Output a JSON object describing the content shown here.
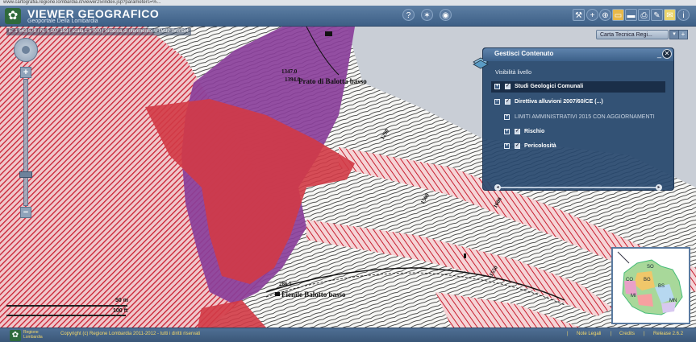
{
  "browser": {
    "url": "www.cartografia.regione.lombardia.it/viewer25/index.jsp?parameters=%..."
  },
  "header": {
    "title": "VIEWER GEOGRAFICO",
    "subtitle": "Geoportale Della Lombardia",
    "tool_icons": [
      "help-icon",
      "identify-icon",
      "globe-icon",
      "tools-icon",
      "add-layer-icon",
      "folder-icon",
      "save-icon",
      "print-icon",
      "edit-icon",
      "mail-icon",
      "info-icon"
    ]
  },
  "map_toolbar": {
    "coordinates": "E: 1 543 579 / N: 5 107 153  |  scala 1:5 000  |  Sistema di riferimento: UTM32-WGS84",
    "basemap_select": "Carta Tecnica Regi..."
  },
  "map": {
    "labels": {
      "place_1": "Prato di Balotta basso",
      "place_2": "Fienile Balotto basso",
      "elev_1": "1347.0",
      "elev_2": "1394.0",
      "elev_3": "1290",
      "elev_4": "1500",
      "elev_5": "1550",
      "elev_6": "1600",
      "elev_7": "286.5"
    },
    "colors": {
      "red": "#d23a46",
      "purple": "#8a3f9a",
      "hatch": "#cc2233"
    }
  },
  "scalebar": {
    "top": "50 m",
    "bottom": "100 ft"
  },
  "overview": {
    "regions": [
      "SO",
      "BG",
      "BS",
      "CO",
      "MI",
      "MN"
    ]
  },
  "panel": {
    "title": "Gestisci Contenuto",
    "minimize": "_",
    "visibility_label": "Visibilità livello",
    "layers": [
      {
        "label": "Studi Geologici Comunali",
        "checked": true,
        "level": 0
      },
      {
        "label": "Direttiva alluvioni 2007/60/CE (...)",
        "checked": true,
        "level": 0
      },
      {
        "label": "LIMITI AMMINISTRATIVI 2015 CON AGGIORNAMENTI",
        "checked": false,
        "level": 1
      },
      {
        "label": "Rischio",
        "checked": true,
        "level": 1
      },
      {
        "label": "Pericolosità",
        "checked": true,
        "level": 1
      }
    ]
  },
  "footer": {
    "region": "Regione Lombardia",
    "copyright": "Copyright (c) Regione Lombardia 2011-2012 - tutti i diritti riservati",
    "links": [
      "Note Legali",
      "Credits",
      "Release 2.6.2"
    ]
  }
}
